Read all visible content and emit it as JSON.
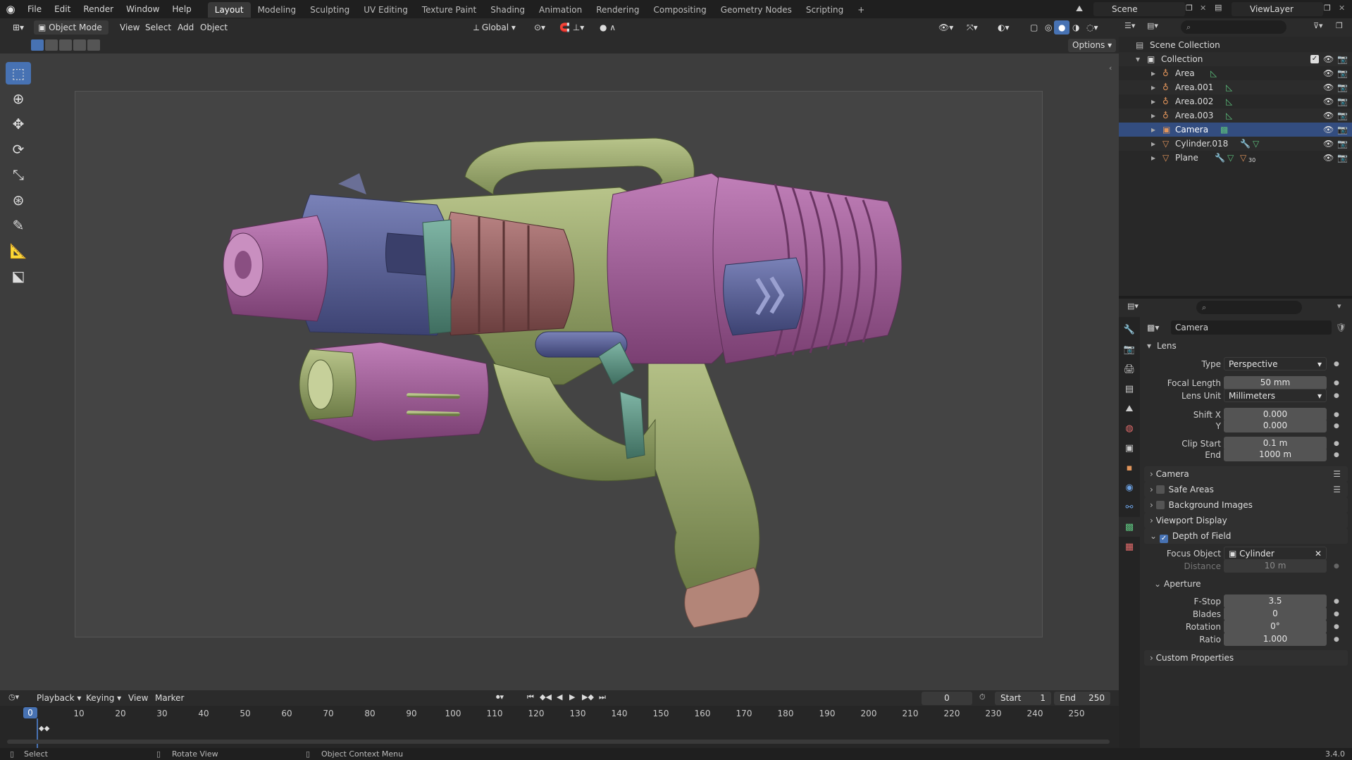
{
  "menu": {
    "items": [
      "File",
      "Edit",
      "Render",
      "Window",
      "Help"
    ]
  },
  "workspaces": [
    "Layout",
    "Modeling",
    "Sculpting",
    "UV Editing",
    "Texture Paint",
    "Shading",
    "Animation",
    "Rendering",
    "Compositing",
    "Geometry Nodes",
    "Scripting"
  ],
  "active_workspace": "Layout",
  "add_tab": "+",
  "scene": {
    "name": "Scene",
    "view_layer": "ViewLayer"
  },
  "viewport": {
    "mode": "Object Mode",
    "menus": [
      "View",
      "Select",
      "Add",
      "Object"
    ],
    "orientation": "Global",
    "options": "Options"
  },
  "outliner": {
    "root": "Scene Collection",
    "collection": "Collection",
    "items": [
      {
        "name": "Area",
        "type": "light"
      },
      {
        "name": "Area.001",
        "type": "light"
      },
      {
        "name": "Area.002",
        "type": "light"
      },
      {
        "name": "Area.003",
        "type": "light"
      },
      {
        "name": "Camera",
        "type": "camera"
      },
      {
        "name": "Cylinder.018",
        "type": "mesh"
      },
      {
        "name": "Plane",
        "type": "mesh",
        "badge": "30"
      }
    ]
  },
  "properties": {
    "object": "Camera",
    "lens": {
      "title": "Lens",
      "type_label": "Type",
      "type": "Perspective",
      "focal_label": "Focal Length",
      "focal": "50 mm",
      "unit_label": "Lens Unit",
      "unit": "Millimeters",
      "shiftx_label": "Shift X",
      "shiftx": "0.000",
      "shifty_label": "Y",
      "shifty": "0.000",
      "clipstart_label": "Clip Start",
      "clipstart": "0.1 m",
      "clipend_label": "End",
      "clipend": "1000 m"
    },
    "panels": {
      "camera": "Camera",
      "safe_areas": "Safe Areas",
      "bg_images": "Background Images",
      "viewport_display": "Viewport Display",
      "dof": "Depth of Field",
      "custom": "Custom Properties"
    },
    "dof": {
      "focus_label": "Focus Object",
      "focus": "Cylinder",
      "distance_label": "Distance",
      "distance": "10 m",
      "aperture": "Aperture",
      "fstop_label": "F-Stop",
      "fstop": "3.5",
      "blades_label": "Blades",
      "blades": "0",
      "rotation_label": "Rotation",
      "rotation": "0°",
      "ratio_label": "Ratio",
      "ratio": "1.000"
    }
  },
  "timeline": {
    "menus": [
      "Playback",
      "Keying",
      "View",
      "Marker"
    ],
    "current": "0",
    "start_label": "Start",
    "start": "1",
    "end_label": "End",
    "end": "250",
    "ticks": [
      "0",
      "10",
      "20",
      "30",
      "40",
      "50",
      "60",
      "70",
      "80",
      "90",
      "100",
      "110",
      "120",
      "130",
      "140",
      "150",
      "160",
      "170",
      "180",
      "190",
      "200",
      "210",
      "220",
      "230",
      "240",
      "250"
    ]
  },
  "status": {
    "select": "Select",
    "rotate": "Rotate View",
    "context": "Object Context Menu",
    "version": "3.4.0"
  }
}
